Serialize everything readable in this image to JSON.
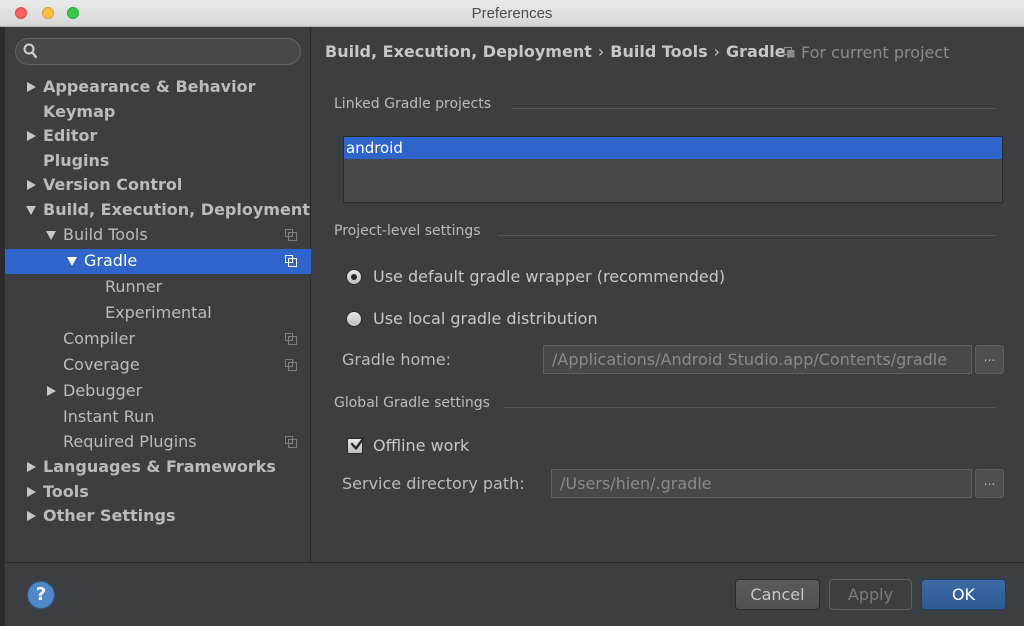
{
  "window": {
    "title": "Preferences"
  },
  "colors": {
    "selection": "#2f65ca",
    "panel": "#3c3f41",
    "accent_ok": "#365880"
  },
  "sidebar": {
    "search": {
      "value": "",
      "placeholder": ""
    },
    "items": [
      {
        "label": "Appearance & Behavior",
        "level": 0,
        "arrow": "right",
        "bold": true,
        "copy_icon": false
      },
      {
        "label": "Keymap",
        "level": 0,
        "arrow": "none",
        "bold": true,
        "copy_icon": false
      },
      {
        "label": "Editor",
        "level": 0,
        "arrow": "right",
        "bold": true,
        "copy_icon": false
      },
      {
        "label": "Plugins",
        "level": 0,
        "arrow": "none",
        "bold": true,
        "copy_icon": false
      },
      {
        "label": "Version Control",
        "level": 0,
        "arrow": "right",
        "bold": true,
        "copy_icon": false
      },
      {
        "label": "Build, Execution, Deployment",
        "level": 0,
        "arrow": "down",
        "bold": true,
        "copy_icon": false
      },
      {
        "label": "Build Tools",
        "level": 1,
        "arrow": "down",
        "bold": false,
        "copy_icon": true
      },
      {
        "label": "Gradle",
        "level": 2,
        "arrow": "down",
        "bold": false,
        "copy_icon": true,
        "selected": true
      },
      {
        "label": "Runner",
        "level": 3,
        "arrow": "none",
        "bold": false,
        "copy_icon": false
      },
      {
        "label": "Experimental",
        "level": 3,
        "arrow": "none",
        "bold": false,
        "copy_icon": false
      },
      {
        "label": "Compiler",
        "level": 1,
        "arrow": "none",
        "bold": false,
        "copy_icon": true
      },
      {
        "label": "Coverage",
        "level": 1,
        "arrow": "none",
        "bold": false,
        "copy_icon": true
      },
      {
        "label": "Debugger",
        "level": 1,
        "arrow": "right",
        "bold": false,
        "copy_icon": false
      },
      {
        "label": "Instant Run",
        "level": 1,
        "arrow": "none",
        "bold": false,
        "copy_icon": false
      },
      {
        "label": "Required Plugins",
        "level": 1,
        "arrow": "none",
        "bold": false,
        "copy_icon": true
      },
      {
        "label": "Languages & Frameworks",
        "level": 0,
        "arrow": "right",
        "bold": true,
        "copy_icon": false
      },
      {
        "label": "Tools",
        "level": 0,
        "arrow": "right",
        "bold": true,
        "copy_icon": false
      },
      {
        "label": "Other Settings",
        "level": 0,
        "arrow": "right",
        "bold": true,
        "copy_icon": false
      }
    ]
  },
  "breadcrumb": {
    "parts": [
      "Build, Execution, Deployment",
      "Build Tools",
      "Gradle"
    ],
    "separator": "›",
    "scope_label": "For current project"
  },
  "linked_projects": {
    "title": "Linked Gradle projects",
    "items": [
      "android"
    ]
  },
  "project_settings": {
    "title": "Project-level settings",
    "options": [
      {
        "label": "Use default gradle wrapper (recommended)",
        "checked": true
      },
      {
        "label": "Use local gradle distribution",
        "checked": false
      }
    ],
    "gradle_home": {
      "label": "Gradle home:",
      "value": "/Applications/Android Studio.app/Contents/gradle"
    },
    "browse_label": "..."
  },
  "global_settings": {
    "title": "Global Gradle settings",
    "offline": {
      "label": "Offline work",
      "checked": true
    },
    "service_dir": {
      "label": "Service directory path:",
      "value": "/Users/hien/.gradle"
    },
    "browse_label": "..."
  },
  "footer": {
    "help_label": "?",
    "cancel": "Cancel",
    "apply": "Apply",
    "ok": "OK"
  }
}
